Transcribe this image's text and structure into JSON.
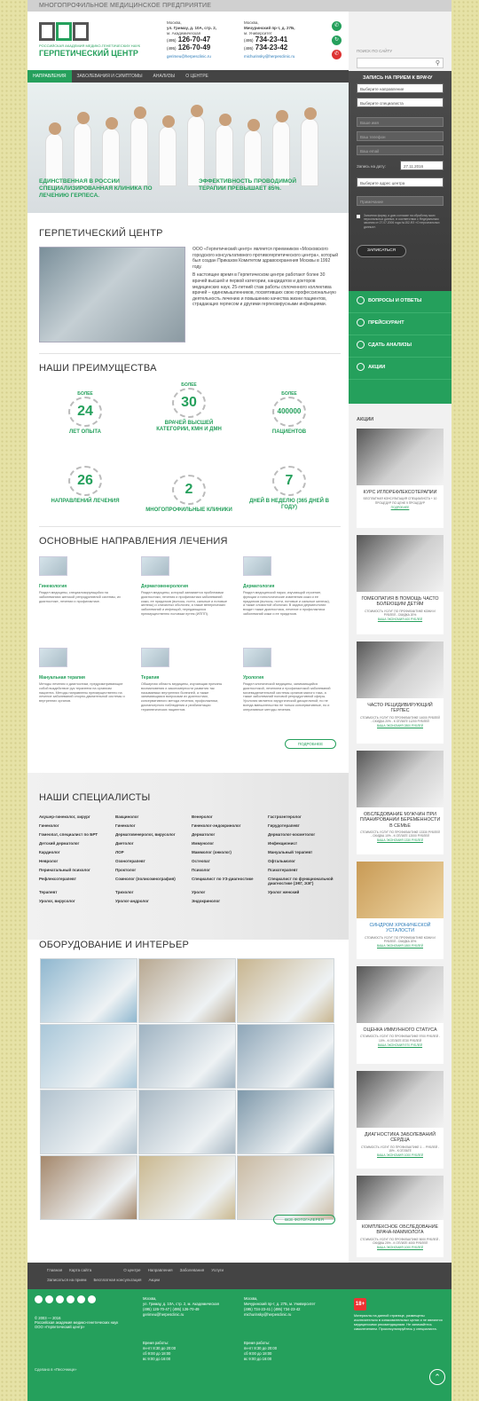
{
  "topbar": "МНОГОПРОФИЛЬНОЕ МЕДИЦИНСКОЕ ПРЕДПРИЯТИЕ",
  "logo": {
    "sub": "РОССИЙСКАЯ АКАДЕМИЯ МЕДИКО-ГЕНЕТИЧЕСКИХ НАУК",
    "title": "ГЕРПЕТИЧЕСКИЙ ЦЕНТР"
  },
  "contact1": {
    "city": "Москва,",
    "addr": "ул. Гримау, д. 10А, стр. 2,",
    "metro": "м. Академическая",
    "ph1": "126-70-47",
    "ph2": "126-70-49",
    "code": "(495)",
    "mail": "gerimeu@herpesclinic.ru"
  },
  "contact2": {
    "city": "Москва,",
    "addr": "Мичуринский пр-т, д. 27Б,",
    "metro": "м. Университет",
    "ph1": "734-23-41",
    "ph2": "734-23-42",
    "code": "(495)",
    "mail": "michurinsky@herpesclinic.ru"
  },
  "nav": [
    "НАПРАВЛЕНИЯ",
    "ЗАБОЛЕВАНИЯ И СИМПТОМЫ",
    "АНАЛИЗЫ",
    "О ЦЕНТРЕ"
  ],
  "hero": {
    "cap1": "ЕДИНСТВЕННАЯ В РОССИИ СПЕЦИАЛИЗИРОВАННАЯ КЛИНИКА ПО ЛЕЧЕНИЮ ГЕРПЕСА.",
    "cap2": "ЭФФЕКТИВНОСТЬ ПРОВОДИМОЙ ТЕРАПИИ ПРЕВЫШАЕТ 85%."
  },
  "about": {
    "title": "ГЕРПЕТИЧЕСКИЙ ЦЕНТР",
    "p1": "ООО «Герпетический центр» является преемником «Московского городского консультативного противогерпетического центра», который был создан Приказом Комитетом здравоохранения Москвы в 1992 году.",
    "p2": "В настоящее время в Герпетическом центре работают более 30 врачей высшей и первой категории, кандидатов и докторов медицинских наук. 25-летний стаж работы сплоченного коллектива врачей – единомышленников, посвятивших свою профессиональную деятельность лечению и повышению качества жизни пациентов, страдающих герпесом и другими герпесвирусными инфекциями."
  },
  "adv": {
    "title": "НАШИ ПРЕИМУЩЕСТВА",
    "more": "БОЛЕЕ",
    "items": [
      {
        "num": "24",
        "label": "ЛЕТ ОПЫТА"
      },
      {
        "num": "30",
        "label": "ВРАЧЕЙ ВЫСШЕЙ КАТЕГОРИИ, КМН И ДМН"
      },
      {
        "num": "400000",
        "label": "ПАЦИЕНТОВ"
      },
      {
        "num": "26",
        "label": "НАПРАВЛЕНИЙ ЛЕЧЕНИЯ"
      },
      {
        "num": "2",
        "label": "МНОГОПРОФИЛЬНЫЕ КЛИНИКИ"
      },
      {
        "num": "7",
        "label": "ДНЕЙ В НЕДЕЛЮ (365 ДНЕЙ В ГОДУ)"
      }
    ]
  },
  "dirs": {
    "title": "ОСНОВНЫЕ НАПРАВЛЕНИЯ ЛЕЧЕНИЯ",
    "items": [
      {
        "t": "Гинекология",
        "d": "Раздел медицины, специализирующийся на заболеваниях женской репродуктивной системы, их диагностике, лечении и профилактике."
      },
      {
        "t": "Дерматовенерология",
        "d": "Раздел медицины, который занимается проблемами диагностики, лечения и профилактики заболеваний кожи, ее придатков (волосы, ногти, сальные и потовые железы) и слизистых оболочек, а также венерических заболеваний и инфекций, передающихся преимущественно половым путем (ИППП)."
      },
      {
        "t": "Дерматология",
        "d": "Раздел медицинской науки, изучающий строение, функции и патологические изменения кожи и ее придатков (волосы, ногти, потовые и сальные железы), а также слизистой оболочки. В задачи дерматологии входит также диагностика, лечение и профилактика заболеваний кожи и ее придатков."
      },
      {
        "t": "Мануальная терапия",
        "d": "Методы лечения и диагностики, предусматривающие собой воздействие рук терапевта на организм пациента. Методы направлены преимущественно на лечение заболеваний опорно-двигательной системы и внутренних органов."
      },
      {
        "t": "Терапия",
        "d": "Обширная область медицины, изучающая причины возникновения и закономерности развития так называемых внутренних болезней, а также занимающаяся вопросами их диагностики, консервативного метода лечения, профилактики, диспансерного наблюдения и реабилитации терапевтических пациентов."
      },
      {
        "t": "Урология",
        "d": "Раздел клинической медицины, занимающийся диагностикой, лечением и профилактикой заболеваний мочевыделительной системы органов малого таза, а также заболеваний половой репродуктивной сферы. Урология является хирургической дисциплиной, но не всегда вмешательство не только консервативные, но и оперативные методы лечения."
      }
    ],
    "btn": "ПОДРОБНЕЕ"
  },
  "spec": {
    "title": "НАШИ СПЕЦИАЛИСТЫ",
    "items": [
      "Акушер-гинеколог, хирург",
      "Вакцинолог",
      "Венеролог",
      "Гастроэнтеролог",
      "Гинеколог",
      "Гинеколог",
      "Гинеколог-эндокринолог",
      "Гирудотерапевт",
      "Гомеопат, специалист по БРТ",
      "Дерматовенеролог, вирусолог",
      "Дерматолог",
      "Дерматолог-косметолог",
      "Детский дерматолог",
      "Диетолог",
      "Иммунолог",
      "Инфекционист",
      "Кардиолог",
      "ЛОР",
      "Маммолог (онколог)",
      "Мануальный терапевт",
      "Невролог",
      "Озонотерапевт",
      "Остеопат",
      "Офтальмолог",
      "Перинатальный психолог",
      "Проктолог",
      "Психолог",
      "Психотерапевт",
      "Рефлексотерапевт",
      "Сомнолог (полисомнография)",
      "Специалист по УЗ-диагностике",
      "Специалист по функциональной диагностике (ЭКГ, ЭЭГ)",
      "Терапевт",
      "Трихолог",
      "Уролог",
      "Уролог женский",
      "Уролог, вирусолог",
      "Уролог-андролог",
      "Эндокринолог",
      ""
    ]
  },
  "gallery": {
    "title": "ОБОРУДОВАНИЕ И ИНТЕРЬЕР",
    "btn": "ВСЕ ФОТОГАЛЕРЕЯ",
    "colors": [
      "#8fb7cf",
      "#b8a891",
      "#c8b58f",
      "#a9c7d9",
      "#9fb3c2",
      "#8ea6b8",
      "#b2c3cf",
      "#a8b8c4",
      "#7e98aa",
      "#a4876b",
      "#cab88f",
      "#c9b9a1"
    ]
  },
  "side": {
    "search_label": "ПОИСК ПО САЙТУ",
    "form_title": "ЗАПИСЬ НА ПРИЕМ К ВРАЧУ",
    "sel1": "Выберите направление",
    "sel2": "Выберите специалиста",
    "name": "Ваше имя",
    "phone": "Ваш телефон",
    "email": "Ваш email",
    "date_label": "Запись на дату:",
    "date": "27.11.2016",
    "sel3": "Выберите адрес центра",
    "comment": "Примечание",
    "note": "Заполняя форму, я даю согласие на обработку моих персональных данных, в соответствии с Федеральным законом от 27.07.2006 года №152-ФЗ «О персональных данных».",
    "send": "ЗАПИСАТЬСЯ",
    "menu": [
      "ВОПРОСЫ И ОТВЕТЫ",
      "ПРЕЙСКУРАНТ",
      "СДАТЬ АНАЛИЗЫ",
      "АКЦИИ"
    ],
    "promo_title": "АКЦИИ",
    "promos": [
      {
        "t": "КУРС ИГЛОРЕФЛЕКСОТЕРАПИИ",
        "d": "БЕСПЛАТНАЯ КОНСУЛЬТАЦИЯ СПЕЦИАЛИСТА + 10 ПРОЦЕДУР ПО ЦЕНЕ 9 ПРОЦЕДУР",
        "l": "ПОДРОБНЕЕ"
      },
      {
        "t": "ГОМЕОПАТИЯ В ПОМОЩЬ ЧАСТО БОЛЕЮЩИМ ДЕТЯМ",
        "d": "СТОИМОСТЬ УСЛУГ ПО ПРОФИЛАКТИКЕ КОЖИ И РУБЛЕЙ - СКИДКА 20%",
        "l": "ВАША ЭКОНОМИЯ 400 РУБЛЕЙ"
      },
      {
        "t": "ЧАСТО РЕЦИДИВИРУЮЩИЙ ГЕРПЕС",
        "d": "СТОИМОСТЬ УСЛУГ ПО ПРОФИЛАКТИКЕ 14000 РУБЛЕЙ - СКИДКА 20% - К ОПЛАТЕ 11200 РУБЛЕЙ",
        "l": "ВАША ЭКОНОМИЯ 2800 РУБЛЕЙ"
      },
      {
        "t": "ОБСЛЕДОВАНИЕ МУЖЧИН ПРИ ПЛАНИРОВАНИИ БЕРЕМЕННОСТИ В СЕМЬЕ",
        "d": "СТОИМОСТЬ УСЛУГ ПО ПРОФИЛАКТИКЕ 13330 РУБЛЕЙ - СКИДКА 10% - К ОПЛАТЕ 12000 РУБЛЕЙ",
        "l": "ВАША ЭКОНОМИЯ 1330 РУБЛЕЙ"
      },
      {
        "t": "СИНДРОМ ХРОНИЧЕСКОЙ УСТАЛОСТИ",
        "d": "СТОИМОСТЬ УСЛУГ ПО ПРОФИЛАКТИКЕ КОЖИ И РУБЛЕЙ - СКИДКА 20%",
        "l": "ВАША ЭКОНОМИЯ 1800 РУБЛЕЙ"
      },
      {
        "t": "ОЦЕНКА ИММУННОГО СТАТУСА",
        "d": "СТОИМОСТЬ УСЛУГ ПО ПРОФИЛАКТИКЕ 9700 РУБЛЕЙ - 10% - К ОПЛАТЕ 8730 РУБЛЕЙ",
        "l": "ВАША ЭКОНОМИЯ 970 РУБЛЕЙ"
      },
      {
        "t": "ДИАГНОСТИКА ЗАБОЛЕВАНИЙ СЕРДЦА",
        "d": "СТОИМОСТЬ УСЛУГ ПО ПРОФИЛАКТИКЕ 1 ... РУБЛЕЙ - 15% - К ОПЛАТЕ",
        "l": "ВАША ЭКОНОМИЯ 1000 РУБЛЕЙ"
      },
      {
        "t": "КОМПЛЕКСНОЕ ОБСЛЕДОВАНИЕ ВРАЧА-МАММОЛОГА",
        "d": "СТОИМОСТЬ УСЛУГ ПО ПРОФИЛАКТИКЕ 5000 РУБЛЕЙ - СКИДКА 20% - К ОПЛАТЕ 4000 РУБЛЕЙ",
        "l": "ВАША ЭКОНОМИЯ 1000 РУБЛЕЙ"
      }
    ]
  },
  "footer": {
    "links1": [
      "Главная",
      "Карта сайта",
      "О центре",
      "Направления",
      "Заболевания",
      "Услуги"
    ],
    "links2": [
      "Записаться на прием",
      "Бесплатная консультация",
      "Акции"
    ],
    "copy": "© 2003 — 2016\nРоссийская академия медико-генетических наук\nООО «Герпетический центр»",
    "dev": "Сделано в «Песочнице»",
    "addr1": "Москва,\nул. Гримау, д. 10А, стр. 2, м. Академическая\n(495) 126-70-47 | (495) 126-70-49\ngerimeu@herpesclinic.ru",
    "addr2": "Москва,\nМичуринский пр-т, д. 27Б, м. Университет\n(495) 734-23-41 | (495) 734-23-42\nmichurinsky@herpesclinic.ru",
    "hours": "Время работы:\nпн-пт 8:30 до 20:00\nсб 9:00 до 18:00\nвс 9:00 до 16:00",
    "age": "18+",
    "warn": "Материалы на данной странице, размещены исключительно в ознакомительных целях и не являются медицинскими рекомендациями. Не занимайтесь самолечением. Проконсультируйтесь у специалиста."
  }
}
